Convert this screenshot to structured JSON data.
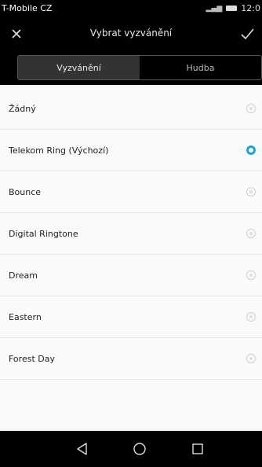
{
  "status_bar": {
    "carrier": "T-Mobile CZ",
    "time": "12:0"
  },
  "app_bar": {
    "title": "Vybrat vyzvánění"
  },
  "tabs": [
    {
      "label": "Vyzvánění",
      "active": true
    },
    {
      "label": "Hudba",
      "active": false
    }
  ],
  "ringtones": [
    {
      "label": "Žádný",
      "selected": false
    },
    {
      "label": "Telekom Ring (Výchozí)",
      "selected": true
    },
    {
      "label": "Bounce",
      "selected": false
    },
    {
      "label": "Digital Ringtone",
      "selected": false
    },
    {
      "label": "Dream",
      "selected": false
    },
    {
      "label": "Eastern",
      "selected": false
    },
    {
      "label": "Forest Day",
      "selected": false
    }
  ],
  "colors": {
    "accent": "#1aa3d9",
    "bar_background": "#000000",
    "list_background": "#fafafa"
  },
  "icons": {
    "close": "close-icon",
    "confirm": "checkmark-icon",
    "back": "back-triangle-icon",
    "home": "home-circle-icon",
    "recents": "recents-square-icon"
  }
}
